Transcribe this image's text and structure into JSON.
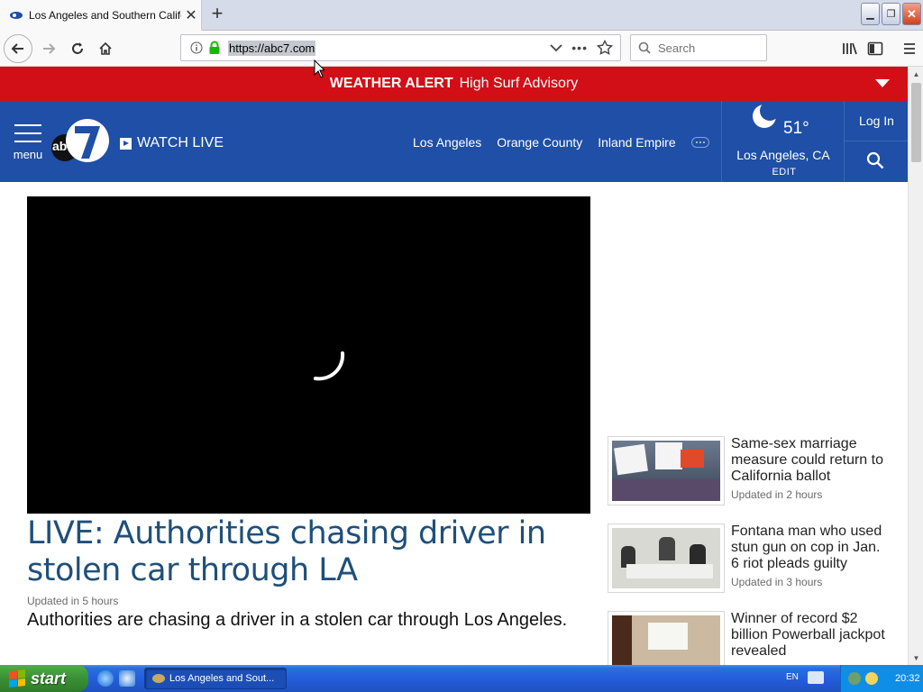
{
  "browser": {
    "tab_title": "Los Angeles and Southern Californ",
    "url": "https://abc7.com",
    "search_placeholder": "Search"
  },
  "site": {
    "alert_title": "WEATHER ALERT",
    "alert_text": "High Surf Advisory",
    "menu_label": "menu",
    "logo_text": "abc",
    "watch_live": "WATCH LIVE",
    "nav": [
      "Los Angeles",
      "Orange County",
      "Inland Empire"
    ],
    "weather": {
      "temp": "51°",
      "location": "Los Angeles, CA",
      "edit": "EDIT"
    },
    "login": "Log In",
    "brand_color": "#1f4fa6",
    "alert_color": "#d20e17"
  },
  "main": {
    "headline": "LIVE: Authorities chasing driver in stolen car through LA",
    "updated": "Updated in 5 hours",
    "summary": "Authorities are chasing a driver in a stolen car through Los Angeles."
  },
  "stories": [
    {
      "title": "Same-sex marriage measure could return to California ballot",
      "updated": "Updated in 2 hours"
    },
    {
      "title": "Fontana man who used stun gun on cop in Jan. 6 riot pleads guilty",
      "updated": "Updated in 3 hours"
    },
    {
      "title": "Winner of record $2 billion Powerball jackpot revealed",
      "updated": ""
    }
  ],
  "taskbar": {
    "start": "start",
    "window_title": "Los Angeles and Sout...",
    "lang": "EN",
    "clock": "20:32"
  }
}
